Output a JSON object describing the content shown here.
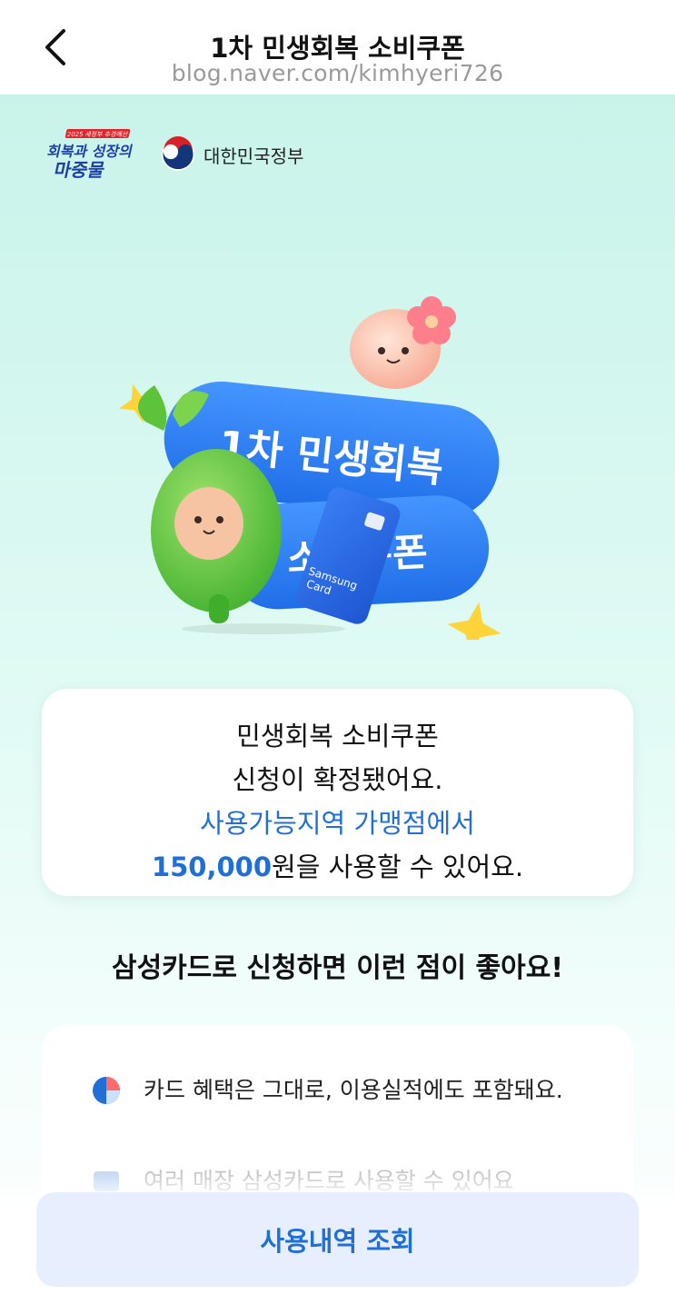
{
  "header": {
    "title": "1차 민생회복 소비쿠폰",
    "subtitle": "blog.naver.com/kimhyeri726"
  },
  "logos": {
    "campaign_small": "2025 새정부 추경예산",
    "campaign_line1": "회복과 성장의",
    "campaign_line2": "마중물",
    "government": "대한민국정부"
  },
  "hero": {
    "pill1": "1차 민생회복",
    "pill2": "소비쿠폰",
    "card_brand_line1": "Samsung",
    "card_brand_line2": "Card"
  },
  "info": {
    "line1": "민생회복 소비쿠폰",
    "line2": "신청이 확정됐어요.",
    "line3": "사용가능지역 가맹점에서",
    "amount": "150,000",
    "line4_suffix": "원을 사용할 수 있어요."
  },
  "section_title": "삼성카드로 신청하면 이런 점이 좋아요!",
  "benefits": [
    {
      "icon": "pie-chart-icon",
      "text": "카드 혜택은 그대로, 이용실적에도 포함돼요."
    },
    {
      "icon": "card-icon",
      "text": "여러 매장 삼성카드로 사용할 수 있어요"
    }
  ],
  "bottom_button": "사용내역 조회",
  "colors": {
    "accent_blue": "#1f6fd6",
    "pill_blue": "#2f7cf0",
    "button_bg": "#e7efff",
    "gradient_top": "#c9f3ea"
  }
}
